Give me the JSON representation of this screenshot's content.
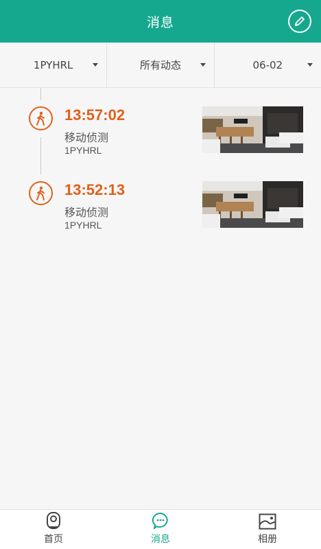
{
  "header": {
    "title": "消息",
    "edit_icon": "pencil-icon"
  },
  "filters": [
    {
      "label": "1PYHRL"
    },
    {
      "label": "所有动态"
    },
    {
      "label": "06-02"
    }
  ],
  "events": [
    {
      "time": "13:57:02",
      "type": "移动侦测",
      "device": "1PYHRL",
      "icon": "walking-person-icon"
    },
    {
      "time": "13:52:13",
      "type": "移动侦测",
      "device": "1PYHRL",
      "icon": "walking-person-icon"
    }
  ],
  "tabbar": {
    "tabs": [
      {
        "label": "首页",
        "icon": "camera-icon",
        "active": false
      },
      {
        "label": "消息",
        "icon": "chat-bubble-icon",
        "active": true
      },
      {
        "label": "相册",
        "icon": "image-icon",
        "active": false
      }
    ]
  },
  "colors": {
    "primary": "#16a88e",
    "accent": "#e0601a",
    "background": "#f6f6f6"
  }
}
